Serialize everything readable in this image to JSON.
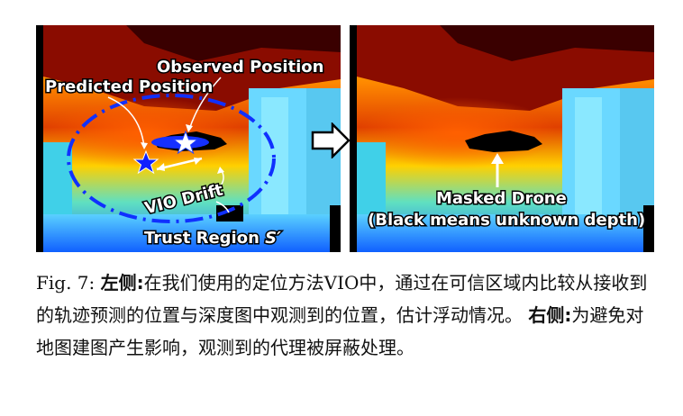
{
  "figure": {
    "left": {
      "observed_label": "Observed Position",
      "predicted_label": "Predicted Position",
      "drift_label": "VIO Drift",
      "trust_label": "Trust Region",
      "trust_symbol": "S′"
    },
    "right": {
      "masked_label": "Masked Drone",
      "unknown_label": "(Black means unknown depth)"
    }
  },
  "caption": {
    "fig_label": "Fig. 7:",
    "left_heading": "左侧:",
    "left_text": "在我们使用的定位方法VIO中，通过在可信区域内比较从接收到的轨迹预测的位置与深度图中观测到的位置，估计浮动情况。",
    "right_heading": "右侧:",
    "right_text": "为避免对地图建图产生影响，观测到的代理被屏蔽处理。"
  }
}
